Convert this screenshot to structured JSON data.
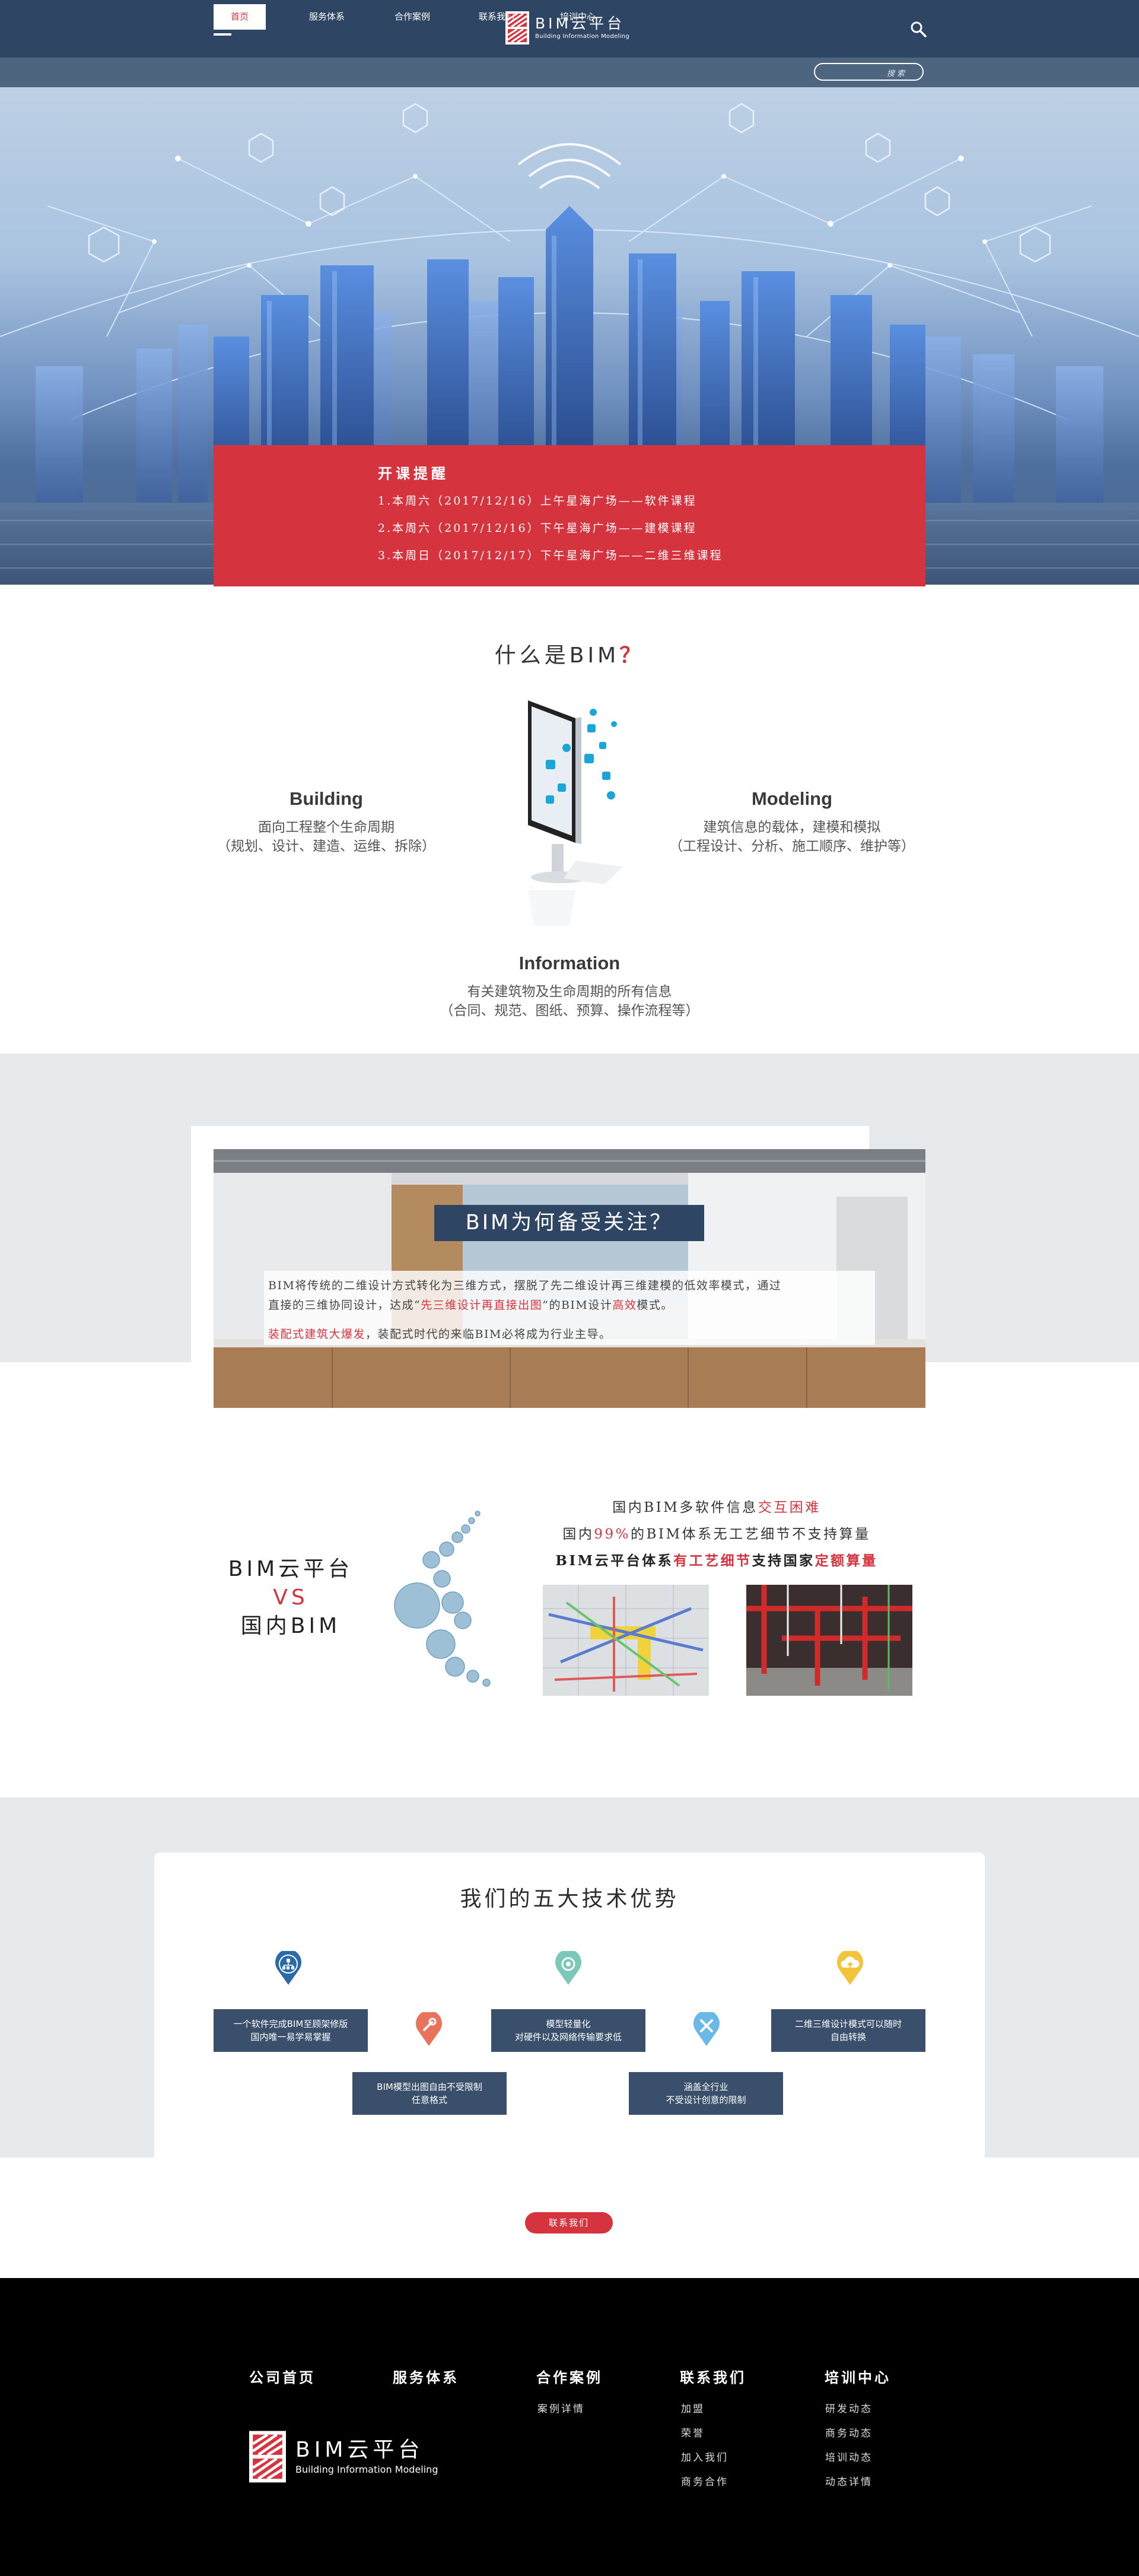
{
  "header": {
    "brand_main": "BIM云平台",
    "brand_sub": "Building Information Modeling",
    "search_placeholder": "搜 索"
  },
  "nav": [
    {
      "label": "首页",
      "active": true
    },
    {
      "label": "服务体系"
    },
    {
      "label": "合作案例"
    },
    {
      "label": "联系我们"
    },
    {
      "label": "培训中心"
    }
  ],
  "notice": {
    "title": "开课提醒",
    "items": [
      "1.本周六（2017/12/16）上午星海广场——软件课程",
      "2.本周六（2017/12/16）下午星海广场——建模课程",
      "3.本周日（2017/12/17）下午星海广场——二维三维课程"
    ]
  },
  "what": {
    "title": "什么是BIM",
    "question_mark": "？",
    "building": {
      "head": "Building",
      "line1": "面向工程整个生命周期",
      "line2": "（规划、设计、建造、运维、拆除）"
    },
    "modeling": {
      "head": "Modeling",
      "line1": "建筑信息的载体，建模和模拟",
      "line2": "（工程设计、分析、施工顺序、维护等）"
    },
    "information": {
      "head": "Information",
      "line1": "有关建筑物及生命周期的所有信息",
      "line2": "（合同、规范、图纸、预算、操作流程等）"
    }
  },
  "why": {
    "title": "BIM为何备受关注？",
    "p1_a": "BIM将传统的二维设计方式转化为三维方式，摆脱了先二维设计再三维建模的低效率模式，通过",
    "p1_b": "直接的三维协同设计，达成“",
    "p1_red": "先三维设计再直接出图",
    "p1_c": "”的BIM设计",
    "p1_red2": "高效",
    "p1_d": "模式。",
    "p2_red": "装配式建筑大爆发",
    "p2_rest": "，装配式时代的来临BIM必将成为行业主导。"
  },
  "vs": {
    "left_top": "BIM云平台",
    "left_vs": "VS",
    "left_bottom": "国内BIM",
    "line1_a": "国内BIM多软件信息",
    "line1_red": "交互困难",
    "line2_a": "国内",
    "line2_red": "99%",
    "line2_b": "的BIM体系无工艺细节不支持算量",
    "line3_a": "BIM云平台体系",
    "line3_red": "有工艺细节",
    "line3_b": "支持国家",
    "line3_red2": "定额算量"
  },
  "advantages": {
    "title": "我们的五大技术优势",
    "items": [
      {
        "l1": "一个软件完成BIM至顾架修版",
        "l2": "国内唯一易学易掌握"
      },
      {
        "l1": "BIM模型出图自由不受限制",
        "l2": "任意格式"
      },
      {
        "l1": "模型轻量化",
        "l2": "对硬件以及网络传输要求低"
      },
      {
        "l1": "涵盖全行业",
        "l2": "不受设计创意的限制"
      },
      {
        "l1": "二维三维设计模式可以随时",
        "l2": "自由转换"
      }
    ],
    "colors": {
      "pin_blue": "#2a6aa8",
      "pin_orange": "#e8725a",
      "pin_teal": "#7bc8b8",
      "pin_sky": "#6ab8e8",
      "pin_yellow": "#f2c43a"
    }
  },
  "contact_button": "联系我们",
  "footer": {
    "columns": [
      {
        "head": "公司首页",
        "links": []
      },
      {
        "head": "服务体系",
        "links": []
      },
      {
        "head": "合作案例",
        "links": [
          "案例详情"
        ]
      },
      {
        "head": "联系我们",
        "links": [
          "加盟",
          "荣誉",
          "加入我们",
          "商务合作"
        ]
      },
      {
        "head": "培训中心",
        "links": [
          "研发动态",
          "商务动态",
          "培训动态",
          "动态详情"
        ]
      }
    ],
    "brand_main": "BIM云平台",
    "brand_sub": "Building Information Modeling"
  }
}
